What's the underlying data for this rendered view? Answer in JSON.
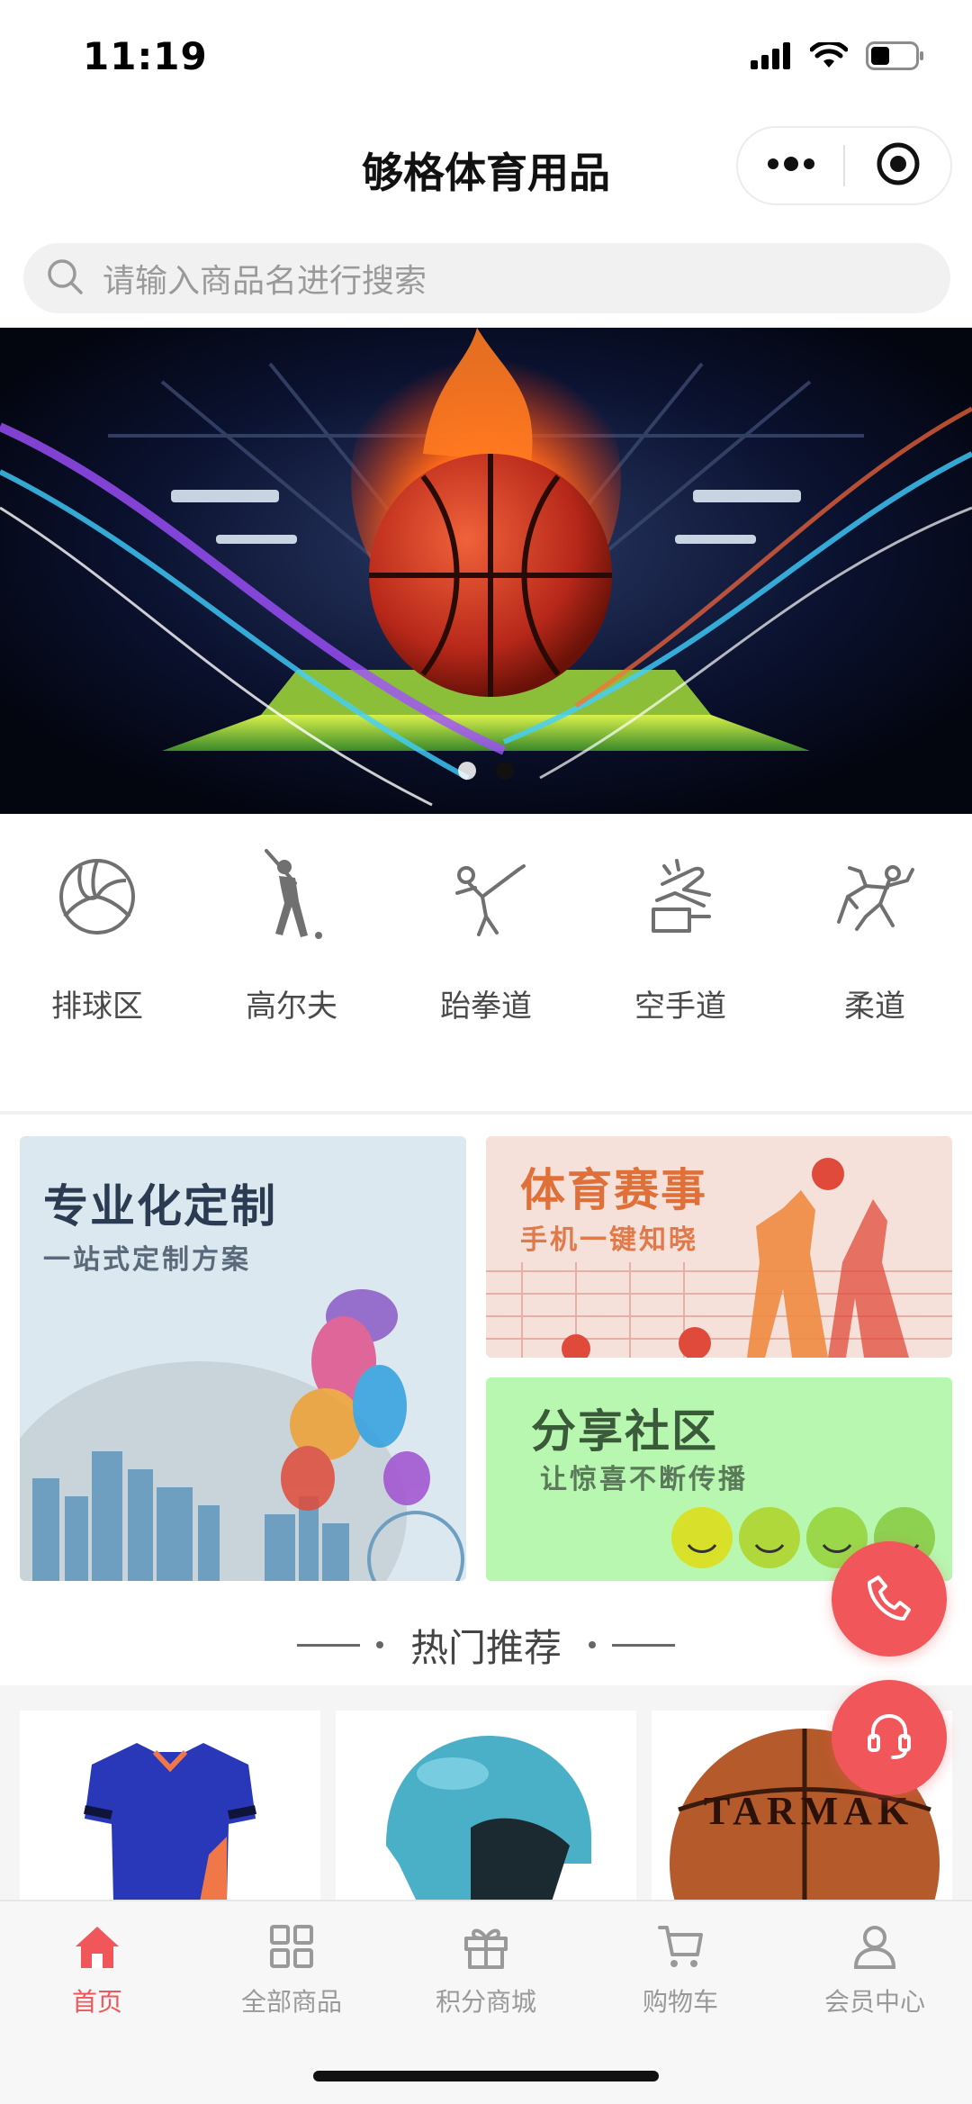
{
  "status_bar": {
    "time": "11:19"
  },
  "header": {
    "title": "够格体育用品"
  },
  "search": {
    "placeholder": "请输入商品名进行搜索"
  },
  "banner": {
    "slide_count": 2,
    "active_index": 1
  },
  "categories": [
    {
      "label": "排球区",
      "icon": "volleyball-icon"
    },
    {
      "label": "高尔夫",
      "icon": "golfer-icon"
    },
    {
      "label": "跆拳道",
      "icon": "taekwondo-kick-icon"
    },
    {
      "label": "空手道",
      "icon": "karate-chop-icon"
    },
    {
      "label": "柔道",
      "icon": "judo-throw-icon"
    }
  ],
  "promos": {
    "custom": {
      "title": "专业化定制",
      "subtitle": "一站式定制方案"
    },
    "events": {
      "title": "体育赛事",
      "subtitle": "手机一键知晓"
    },
    "community": {
      "title": "分享社区",
      "subtitle": "让惊喜不断传播"
    }
  },
  "hot": {
    "title": "热门推荐"
  },
  "products": [
    {
      "image": "blue-jersey"
    },
    {
      "image": "teal-helmet"
    },
    {
      "image": "basketball",
      "brand_text": "TARMAK"
    }
  ],
  "tab_bar": {
    "items": [
      {
        "label": "首页",
        "icon": "home-icon",
        "active": true
      },
      {
        "label": "全部商品",
        "icon": "grid-icon",
        "active": false
      },
      {
        "label": "积分商城",
        "icon": "gift-icon",
        "active": false
      },
      {
        "label": "购物车",
        "icon": "cart-icon",
        "active": false
      },
      {
        "label": "会员中心",
        "icon": "user-icon",
        "active": false
      }
    ]
  },
  "colors": {
    "accent": "#f0565a",
    "inactive": "#999999",
    "icon_gray": "#707070"
  }
}
